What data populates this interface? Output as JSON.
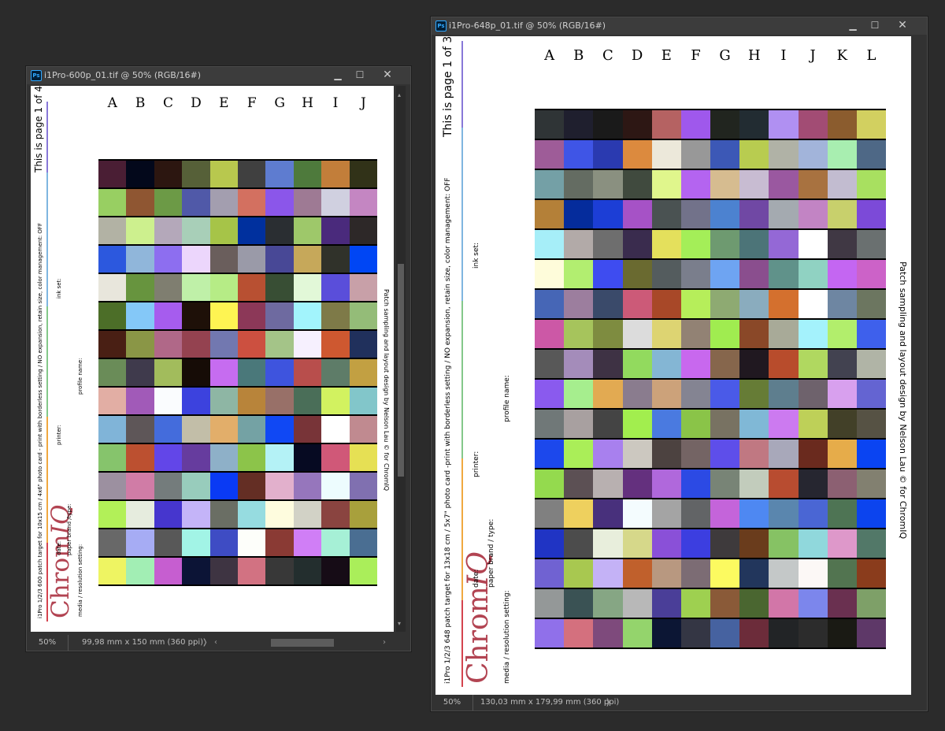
{
  "colors": {
    "bg": "#2b2b2b",
    "accent_purple": "#8878d8",
    "accent_blue": "#7fb6e0",
    "accent_green": "#84c88a",
    "accent_orange": "#f0a840",
    "accent_red": "#d4434e",
    "logo_red": "#b24452"
  },
  "window1": {
    "title": "i1Pro-600p_01.tif @ 50% (RGB/16#)",
    "zoom": "50%",
    "dimensions": "99,98 mm x 150 mm (360 ppi)",
    "page_text": "This is page 1 of 4",
    "description": "i1Pro 1/2/3 600 patch target for 10x15 cm / 4x6\" photo card - print with borderless setting / NO expansion, retain size, color management: OFF",
    "labels": {
      "ink_set": "ink set:",
      "profile_name": "profile name:",
      "printer": "printer:",
      "date": "date:",
      "paper": "paper brand /type:",
      "media": "media / resolution setting:"
    },
    "logo_a": "Chrom",
    "logo_b": "IQ",
    "credit": "Patch sampling and layout design by Nelson Lau © for ChromIQ",
    "columns": [
      "A",
      "B",
      "C",
      "D",
      "E",
      "F",
      "G",
      "H",
      "I",
      "J"
    ],
    "patches": [
      [
        "#4a1e34",
        "#03081b",
        "#2c1610",
        "#566038",
        "#b8c84e",
        "#404040",
        "#5e7cd0",
        "#4e7a3c",
        "#c27e3a",
        "#313218"
      ],
      [
        "#98cf62",
        "#8f5632",
        "#6c9a46",
        "#5059a8",
        "#a39eaf",
        "#d37060",
        "#8b56ea",
        "#9e7a94",
        "#d0d0e0",
        "#c486c2"
      ],
      [
        "#b2b2a4",
        "#cdf08e",
        "#b4a8ba",
        "#a8cfb8",
        "#a6c448",
        "#00309e",
        "#2a2e32",
        "#9ec86a",
        "#4a2a7c",
        "#2d2828"
      ],
      [
        "#2c58de",
        "#90b6da",
        "#8d6ef0",
        "#ecd6fc",
        "#6a5e5c",
        "#9a9aa8",
        "#484896",
        "#c6a85a",
        "#30322a",
        "#0046f4"
      ],
      [
        "#e8e6dc",
        "#67943e",
        "#7f7e70",
        "#bff0a8",
        "#b6ec86",
        "#b85032",
        "#384e34",
        "#e2f8d8",
        "#5a4eda",
        "#c8a0a8"
      ],
      [
        "#4c6e28",
        "#84c8f8",
        "#a65cee",
        "#1e1008",
        "#fef452",
        "#8c3858",
        "#6e6aa0",
        "#a2f4fc",
        "#7e7a48",
        "#94bc78"
      ],
      [
        "#491f14",
        "#8a9646",
        "#b06888",
        "#944250",
        "#7278b0",
        "#cc5040",
        "#a4c488",
        "#f6f0fe",
        "#ce5830",
        "#20305c"
      ],
      [
        "#6a8c58",
        "#3f3a4c",
        "#a2bc5c",
        "#160c06",
        "#c66cf0",
        "#4a787a",
        "#3e54de",
        "#b84e4c",
        "#5e7c68",
        "#c2a042"
      ],
      [
        "#e2aea4",
        "#a15ab8",
        "#fafcfe",
        "#3c42de",
        "#8eb6a4",
        "#b8843a",
        "#987068",
        "#4a6e58",
        "#d2f260",
        "#82c6ca"
      ],
      [
        "#80b4d8",
        "#5e5658",
        "#446cdc",
        "#c2bea8",
        "#e2ae6a",
        "#74a2a4",
        "#1048f4",
        "#783438",
        "#ffffff",
        "#c08a90"
      ],
      [
        "#86c46c",
        "#bc5030",
        "#6246e8",
        "#663c9e",
        "#8eb0c8",
        "#8cc44a",
        "#b4f2f6",
        "#060a22",
        "#d05878",
        "#e6e054"
      ],
      [
        "#9c90a0",
        "#d07ca6",
        "#747c7c",
        "#98ccbc",
        "#0a3af4",
        "#642e24",
        "#e2b0cc",
        "#9676bc",
        "#edfcfe",
        "#8070b0"
      ],
      [
        "#b2f058",
        "#e6ecde",
        "#4636ce",
        "#c4b4f8",
        "#6a6e64",
        "#96dce0",
        "#fefcde",
        "#d2d2c6",
        "#8a4440",
        "#a8a03c"
      ],
      [
        "#686868",
        "#a6acf4",
        "#585858",
        "#a2f4e6",
        "#3e4cc4",
        "#fdfefa",
        "#8a3a34",
        "#d07ef6",
        "#a6f0d6",
        "#4a6e92"
      ],
      [
        "#eef462",
        "#a2eeb4",
        "#c65ed0",
        "#0c1436",
        "#3e3442",
        "#d27282",
        "#383838",
        "#232e2e",
        "#160c16",
        "#aaee5a"
      ]
    ]
  },
  "window2": {
    "title": "i1Pro-648p_01.tif @ 50% (RGB/16#)",
    "zoom": "50%",
    "dimensions": "130,03 mm x 179,99 mm (360 ppi)",
    "page_text": "This is page 1 of 3",
    "description": "i1Pro 1/2/3 648 patch target for 13x18 cm / 5x7\" photo card -print with borderless setting / NO expansion, retain size, color management: OFF",
    "labels": {
      "ink_set": "ink set:",
      "profile_name": "profile name:",
      "printer": "printer:",
      "date": "date:",
      "paper": "paper brand / type:",
      "media": "media / resolution setting:"
    },
    "logo_a": "Chrom",
    "logo_b": "IQ",
    "credit": "Patch sampling and layout design by Nelson Lau © for ChromIQ",
    "columns": [
      "A",
      "B",
      "C",
      "D",
      "E",
      "F",
      "G",
      "H",
      "I",
      "J",
      "K",
      "L"
    ],
    "patches": [
      [
        "#2f3436",
        "#1f1f2e",
        "#1a1a1a",
        "#2d1714",
        "#b56262",
        "#9f58ec",
        "#21251f",
        "#222c32",
        "#b090f2",
        "#a24c74",
        "#8b5c2e",
        "#d2d060"
      ],
      [
        "#9e5c98",
        "#3f55e6",
        "#2a3ab0",
        "#dc8a3e",
        "#ece8da",
        "#989898",
        "#3c58b6",
        "#b8cc50",
        "#b0b2a6",
        "#a2b4da",
        "#a8eeb0",
        "#4e6886"
      ],
      [
        "#74a0a6",
        "#646c62",
        "#8a9080",
        "#404a3e",
        "#e0f68c",
        "#b464f0",
        "#d6bc90",
        "#c8bcd2",
        "#9a58a0",
        "#a87240",
        "#c2bcd0",
        "#a8e060"
      ],
      [
        "#b48038",
        "#052c9c",
        "#1c3ed6",
        "#a652c6",
        "#4a5252",
        "#72728a",
        "#4c82d0",
        "#7048a4",
        "#a4aab0",
        "#c284c4",
        "#c8d06c",
        "#7c4ad8"
      ],
      [
        "#a6eef8",
        "#b2aaa8",
        "#6e6e6e",
        "#3a2c4e",
        "#e4e05c",
        "#a4ee58",
        "#6e9a70",
        "#4c7478",
        "#9468d6",
        "#ffffff",
        "#403844",
        "#6a7070"
      ],
      [
        "#fefcda",
        "#b2ee70",
        "#3e4cf0",
        "#6a6a30",
        "#545c5e",
        "#7a7e8c",
        "#6ea4f2",
        "#8a4e8e",
        "#60928a",
        "#90d2c2",
        "#c466f2",
        "#cc62c8"
      ],
      [
        "#4666b6",
        "#9c7e9e",
        "#3a4a6a",
        "#cc5a78",
        "#a84828",
        "#b6ee5a",
        "#8eaa72",
        "#8aacbe",
        "#d4702e",
        "#ffffff",
        "#6e86a2",
        "#6c7660"
      ],
      [
        "#cc58a6",
        "#a6c45c",
        "#7e8c40",
        "#dcdcdc",
        "#ddd472",
        "#928274",
        "#a0ec50",
        "#8a4828",
        "#a8aa98",
        "#a4f2fc",
        "#b2ee6c",
        "#3e60ec"
      ],
      [
        "#585858",
        "#a48cba",
        "#3e3244",
        "#92da5e",
        "#84b6d4",
        "#c868ee",
        "#86664c",
        "#201820",
        "#b84c2c",
        "#b0d860",
        "#424250",
        "#b0b4a6"
      ],
      [
        "#8a5aee",
        "#a6ee8e",
        "#e2aa52",
        "#8a7c8e",
        "#cca27a",
        "#848492",
        "#4a5ae8",
        "#667c36",
        "#5e7e8e",
        "#6e626c",
        "#d8a0ee",
        "#6464d2"
      ],
      [
        "#707878",
        "#a8a0a0",
        "#444444",
        "#a2ee4e",
        "#4a7ae0",
        "#8ac448",
        "#787262",
        "#80b8d6",
        "#cc7af0",
        "#bed058",
        "#424028",
        "#565244"
      ],
      [
        "#1c48ec",
        "#aaee58",
        "#a880ee",
        "#ccc8c0",
        "#4c4240",
        "#746464",
        "#5e4eea",
        "#c07882",
        "#a8a8ba",
        "#6a2a1e",
        "#e6ac4a",
        "#0a44f2"
      ],
      [
        "#94da4e",
        "#5c5054",
        "#b8b0b0",
        "#64307e",
        "#b068dc",
        "#2c4ae4",
        "#788476",
        "#c2ccbc",
        "#b84c30",
        "#262630",
        "#8c6072",
        "#828070"
      ],
      [
        "#808080",
        "#eed05e",
        "#48307c",
        "#f4fcfe",
        "#a4a4a4",
        "#626466",
        "#c464da",
        "#4e88f2",
        "#5a86ae",
        "#4a66d4",
        "#4e7454",
        "#0c44ee"
      ],
      [
        "#2034c4",
        "#4c4c4c",
        "#e8eedc",
        "#d6d88a",
        "#8a50d8",
        "#3c3ee0",
        "#3e3a3c",
        "#6a3c1c",
        "#86c264",
        "#90d8dc",
        "#de98ca",
        "#527868"
      ],
      [
        "#7062d2",
        "#a8c850",
        "#c4b2f6",
        "#c0602c",
        "#b89880",
        "#7c6c74",
        "#fcfa60",
        "#22365c",
        "#c4c8c8",
        "#fcf8f6",
        "#527450",
        "#8a3c1c"
      ],
      [
        "#949898",
        "#3a5254",
        "#86a684",
        "#b8b8b8",
        "#4a3e98",
        "#9ed050",
        "#8a5a38",
        "#4a6630",
        "#d276a8",
        "#7c86ec",
        "#6a3050",
        "#7ea068"
      ],
      [
        "#9070ea",
        "#d4707e",
        "#7e4a7c",
        "#94d46c",
        "#0c1634",
        "#343644",
        "#4662a0",
        "#6c2c3a",
        "#222426",
        "#2c2c2c",
        "#1a1a14",
        "#5e3868"
      ]
    ]
  }
}
